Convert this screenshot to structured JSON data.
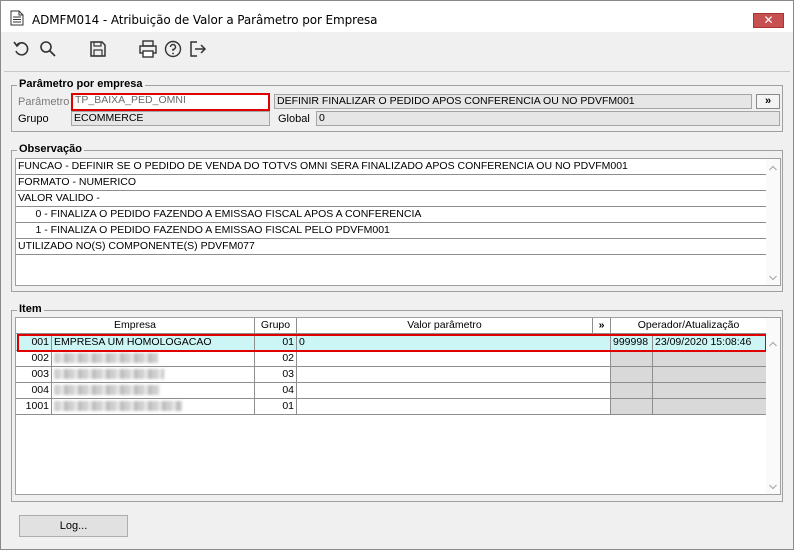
{
  "window": {
    "title": "ADMFM014 - Atribuição de Valor a Parâmetro por Empresa",
    "close_label": "✕"
  },
  "toolbar": {
    "icons": [
      "undo-icon",
      "search-icon",
      "save-icon",
      "print-icon",
      "help-icon",
      "exit-icon"
    ]
  },
  "parametro_group": {
    "title": "Parâmetro por empresa",
    "parametro_label": "Parâmetro",
    "parametro_value": "TP_BAIXA_PED_OMNI",
    "descricao_value": "DEFINIR FINALIZAR O PEDIDO APOS CONFERENCIA OU NO PDVFM001",
    "expand_label": "»",
    "grupo_label": "Grupo",
    "grupo_value": "ECOMMERCE",
    "global_label": "Global",
    "global_value": "0"
  },
  "observacao": {
    "title": "Observação",
    "lines": [
      "FUNCAO - DEFINIR SE O PEDIDO DE VENDA DO TOTVS OMNI SERA FINALIZADO APOS CONFERENCIA OU NO PDVFM001",
      "FORMATO - NUMERICO",
      "VALOR VALIDO -",
      "      0 - FINALIZA O PEDIDO FAZENDO A EMISSAO FISCAL APOS A CONFERENCIA",
      "      1 - FINALIZA O PEDIDO FAZENDO A EMISSAO FISCAL PELO PDVFM001",
      "UTILIZADO NO(S) COMPONENTE(S) PDVFM077"
    ]
  },
  "item": {
    "title": "Item",
    "headers": {
      "empresa": "Empresa",
      "grupo": "Grupo",
      "valor": "Valor parâmetro",
      "expand": "»",
      "operador": "Operador/Atualização"
    },
    "rows": [
      {
        "code": "001",
        "name": "EMPRESA UM HOMOLOGACAO",
        "grupo": "01",
        "valor": "0",
        "operador": "999998",
        "data": "23/09/2020 15:08:46"
      },
      {
        "code": "002",
        "name": "",
        "grupo": "02",
        "valor": "",
        "operador": "",
        "data": ""
      },
      {
        "code": "003",
        "name": "",
        "grupo": "03",
        "valor": "",
        "operador": "",
        "data": ""
      },
      {
        "code": "004",
        "name": "",
        "grupo": "04",
        "valor": "",
        "operador": "",
        "data": ""
      },
      {
        "code": "1001",
        "name": "",
        "grupo": "01",
        "valor": "",
        "operador": "",
        "data": ""
      }
    ]
  },
  "footer": {
    "log_label": "Log..."
  }
}
